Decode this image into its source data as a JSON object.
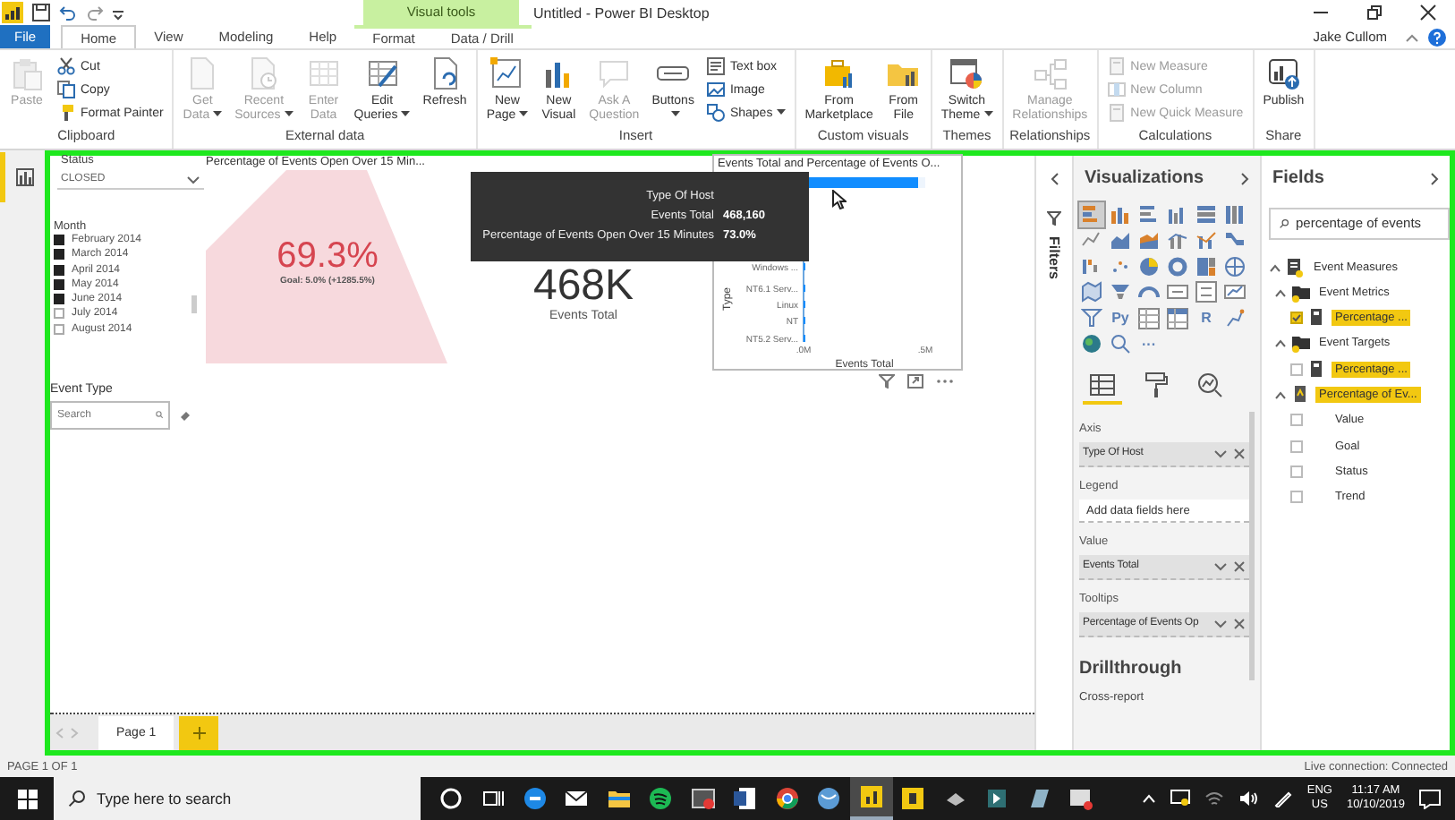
{
  "window": {
    "title": "Untitled - Power BI Desktop",
    "contextual_label": "Visual tools",
    "user": "Jake Cullom"
  },
  "ribbon_tabs": [
    {
      "label": "File",
      "kind": "file",
      "selected": false
    },
    {
      "label": "Home",
      "kind": "tab",
      "selected": true
    },
    {
      "label": "View",
      "kind": "tab",
      "selected": false
    },
    {
      "label": "Modeling",
      "kind": "tab",
      "selected": false
    },
    {
      "label": "Help",
      "kind": "tab",
      "selected": false
    },
    {
      "label": "Format",
      "kind": "contextual",
      "selected": false
    },
    {
      "label": "Data / Drill",
      "kind": "contextual",
      "selected": false
    }
  ],
  "ribbon_groups": [
    {
      "label": "Clipboard",
      "buttons": [
        {
          "kind": "large",
          "lines": [
            "Paste"
          ],
          "disabled": true,
          "dropdown": false
        },
        {
          "kind": "small",
          "lines": [
            "Cut"
          ],
          "disabled": false,
          "dropdown": false
        },
        {
          "kind": "small",
          "lines": [
            "Copy"
          ],
          "disabled": false,
          "dropdown": false
        },
        {
          "kind": "small",
          "lines": [
            "Format Painter"
          ],
          "disabled": false,
          "dropdown": false
        }
      ]
    },
    {
      "label": "External data",
      "buttons": [
        {
          "kind": "large",
          "lines": [
            "Get",
            "Data"
          ],
          "disabled": true,
          "dropdown": true
        },
        {
          "kind": "large",
          "lines": [
            "Recent",
            "Sources"
          ],
          "disabled": true,
          "dropdown": true
        },
        {
          "kind": "large",
          "lines": [
            "Enter",
            "Data"
          ],
          "disabled": true,
          "dropdown": false
        },
        {
          "kind": "large",
          "lines": [
            "Edit",
            "Queries"
          ],
          "disabled": false,
          "dropdown": true
        },
        {
          "kind": "large",
          "lines": [
            "Refresh"
          ],
          "disabled": false,
          "dropdown": false
        }
      ]
    },
    {
      "label": "Insert",
      "buttons": [
        {
          "kind": "large",
          "lines": [
            "New",
            "Page"
          ],
          "disabled": false,
          "dropdown": true
        },
        {
          "kind": "large",
          "lines": [
            "New",
            "Visual"
          ],
          "disabled": false,
          "dropdown": false
        },
        {
          "kind": "large",
          "lines": [
            "Ask A",
            "Question"
          ],
          "disabled": true,
          "dropdown": false
        },
        {
          "kind": "large",
          "lines": [
            "Buttons"
          ],
          "disabled": false,
          "dropdown": true
        },
        {
          "kind": "small",
          "lines": [
            "Text box"
          ],
          "disabled": false,
          "dropdown": false
        },
        {
          "kind": "small",
          "lines": [
            "Image"
          ],
          "disabled": false,
          "dropdown": false
        },
        {
          "kind": "small",
          "lines": [
            "Shapes"
          ],
          "disabled": false,
          "dropdown": true
        }
      ]
    },
    {
      "label": "Custom visuals",
      "buttons": [
        {
          "kind": "large",
          "lines": [
            "From",
            "Marketplace"
          ],
          "disabled": false,
          "dropdown": false
        },
        {
          "kind": "large",
          "lines": [
            "From",
            "File"
          ],
          "disabled": false,
          "dropdown": false
        }
      ]
    },
    {
      "label": "Themes",
      "buttons": [
        {
          "kind": "large",
          "lines": [
            "Switch",
            "Theme"
          ],
          "disabled": false,
          "dropdown": true
        }
      ]
    },
    {
      "label": "Relationships",
      "buttons": [
        {
          "kind": "large",
          "lines": [
            "Manage",
            "Relationships"
          ],
          "disabled": true,
          "dropdown": false
        }
      ]
    },
    {
      "label": "Calculations",
      "buttons": [
        {
          "kind": "small",
          "lines": [
            "New Measure"
          ],
          "disabled": true,
          "dropdown": false
        },
        {
          "kind": "small",
          "lines": [
            "New Column"
          ],
          "disabled": true,
          "dropdown": false
        },
        {
          "kind": "small",
          "lines": [
            "New Quick Measure"
          ],
          "disabled": true,
          "dropdown": false
        }
      ]
    },
    {
      "label": "Share",
      "buttons": [
        {
          "kind": "large",
          "lines": [
            "Publish"
          ],
          "disabled": false,
          "dropdown": false
        }
      ]
    }
  ],
  "report": {
    "status_slicer": {
      "title": "Status",
      "value": "CLOSED"
    },
    "month_slicer": {
      "title": "Month",
      "items": [
        {
          "label": "February 2014",
          "checked": true
        },
        {
          "label": "March 2014",
          "checked": true
        },
        {
          "label": "April 2014",
          "checked": true
        },
        {
          "label": "May 2014",
          "checked": true
        },
        {
          "label": "June 2014",
          "checked": true
        },
        {
          "label": "July 2014",
          "checked": false
        },
        {
          "label": "August 2014",
          "checked": false
        }
      ]
    },
    "event_type_slicer": {
      "title": "Event Type",
      "placeholder": "Search"
    },
    "kpi": {
      "title": "Percentage of Events Open Over 15 Min...",
      "value": "69.3%",
      "goal": "Goal: 5.0% (+1285.5%)"
    },
    "card": {
      "value": "468K",
      "label": "Events Total"
    },
    "bar_chart": {
      "title": "Events Total and Percentage of Events O...",
      "hover_bar": {
        "level": 0.936
      },
      "axis_title_y": "Type",
      "axis_title_x": "Events Total",
      "axis_labels": [
        "Windows ...",
        "NT6.1 Serv...",
        "Linux",
        "NT",
        "NT5.2 Serv..."
      ],
      "tick_labels": [
        ".0M",
        ".5M"
      ]
    },
    "tooltip": {
      "rows": [
        {
          "label": "Type Of Host"
        },
        {
          "label": "Events Total",
          "value": "468,160"
        },
        {
          "label": "Percentage of Events Open Over 15 Minutes",
          "value": "73.0%"
        }
      ]
    },
    "page_tabs": [
      {
        "label": "Page 1",
        "selected": true
      }
    ]
  },
  "filters": {
    "title": "Filters"
  },
  "visualizations": {
    "title": "Visualizations",
    "types": [
      {
        "kind": "icon",
        "selected": true
      },
      {
        "kind": "icon",
        "selected": false
      },
      {
        "kind": "icon",
        "selected": false
      },
      {
        "kind": "icon",
        "selected": false
      },
      {
        "kind": "icon",
        "selected": false
      },
      {
        "kind": "icon",
        "selected": false
      },
      {
        "kind": "icon",
        "selected": false
      },
      {
        "kind": "icon",
        "selected": false
      },
      {
        "kind": "icon",
        "selected": false
      },
      {
        "kind": "icon",
        "selected": false
      },
      {
        "kind": "icon",
        "selected": false
      },
      {
        "kind": "icon",
        "selected": false
      },
      {
        "kind": "icon",
        "selected": false
      },
      {
        "kind": "icon",
        "selected": false
      },
      {
        "kind": "icon",
        "selected": false
      },
      {
        "kind": "icon",
        "selected": false
      },
      {
        "kind": "icon",
        "selected": false
      },
      {
        "kind": "icon",
        "selected": false
      },
      {
        "kind": "icon",
        "selected": false
      },
      {
        "kind": "icon",
        "selected": false
      },
      {
        "kind": "icon",
        "selected": false
      },
      {
        "kind": "icon",
        "selected": false
      },
      {
        "kind": "icon",
        "selected": false
      },
      {
        "kind": "icon",
        "selected": false
      },
      {
        "kind": "icon",
        "selected": false
      },
      {
        "kind": "label",
        "text": "Py",
        "selected": false
      },
      {
        "kind": "icon",
        "selected": false
      },
      {
        "kind": "icon",
        "selected": false
      },
      {
        "kind": "label",
        "text": "R",
        "selected": false
      },
      {
        "kind": "icon",
        "selected": false
      },
      {
        "kind": "icon",
        "selected": false
      },
      {
        "kind": "icon",
        "selected": false
      },
      {
        "kind": "label",
        "text": "···",
        "selected": false
      }
    ],
    "pane_tabs": [
      {
        "selected": true
      },
      {
        "selected": false
      },
      {
        "selected": false
      }
    ],
    "wells": [
      {
        "label": "Axis",
        "field": "Type Of Host"
      },
      {
        "label": "Legend",
        "placeholder": "Add data fields here"
      },
      {
        "label": "Value",
        "field": "Events Total"
      },
      {
        "label": "Tooltips",
        "field": "Percentage of Events Op"
      }
    ],
    "drillthrough": {
      "title": "Drillthrough",
      "label": "Cross-report"
    }
  },
  "fields": {
    "title": "Fields",
    "search": {
      "value": "percentage of events"
    },
    "tree": [
      {
        "label": "Event Measures",
        "kind": "table",
        "expanded": true,
        "highlighted": false,
        "children": [
          {
            "label": "Event Metrics",
            "kind": "folder",
            "expanded": true,
            "highlighted": false,
            "children": [
              {
                "label": "Percentage ...",
                "kind": "measure",
                "checked": true,
                "highlighted": true
              }
            ]
          },
          {
            "label": "Event Targets",
            "kind": "folder",
            "expanded": true,
            "highlighted": false,
            "children": [
              {
                "label": "Percentage ...",
                "kind": "measure",
                "checked": false,
                "highlighted": true
              }
            ]
          },
          {
            "label": "Percentage of Ev...",
            "kind": "kpi",
            "expanded": true,
            "highlighted": true,
            "children": [
              {
                "label": "Value",
                "kind": "field",
                "checked": false,
                "highlighted": false
              },
              {
                "label": "Goal",
                "kind": "field",
                "checked": false,
                "highlighted": false
              },
              {
                "label": "Status",
                "kind": "field",
                "checked": false,
                "highlighted": false
              },
              {
                "label": "Trend",
                "kind": "field",
                "checked": false,
                "highlighted": false
              }
            ]
          }
        ]
      }
    ]
  },
  "status_bar": {
    "page": "PAGE 1 OF 1",
    "connection": "Live connection: Connected"
  },
  "taskbar": {
    "search": {
      "placeholder": "Type here to search"
    },
    "apps": [
      {
        "active": false
      },
      {
        "active": false
      },
      {
        "active": false
      },
      {
        "active": false
      },
      {
        "active": false
      },
      {
        "active": false
      },
      {
        "active": false
      },
      {
        "active": false
      },
      {
        "active": false
      },
      {
        "active": false
      },
      {
        "active": true
      },
      {
        "active": false
      },
      {
        "active": false
      },
      {
        "active": false
      },
      {
        "active": false
      },
      {
        "active": false
      }
    ],
    "language": [
      "ENG",
      "US"
    ],
    "time": "11:17 AM",
    "date": "10/10/2019"
  }
}
